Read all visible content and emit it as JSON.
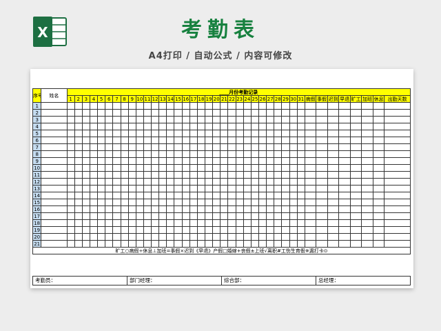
{
  "header": {
    "title": "考勤表",
    "subtitle": "A4打印 / 自动公式 / 内容可修改",
    "logo_icon": "excel-icon",
    "accent": "#17813f"
  },
  "sheet": {
    "col_seq": "序号",
    "col_name": "姓名",
    "month_title": "____月份考勤记录",
    "days": [
      "1",
      "2",
      "3",
      "4",
      "5",
      "6",
      "7",
      "8",
      "9",
      "10",
      "11",
      "12",
      "13",
      "14",
      "15",
      "16",
      "17",
      "18",
      "19",
      "20",
      "21",
      "22",
      "23",
      "24",
      "25",
      "26",
      "27",
      "28",
      "29",
      "30",
      "31"
    ],
    "summary_cols": [
      "病假",
      "事假",
      "迟到",
      "早退",
      "旷工",
      "加班",
      "休息",
      "出勤天数"
    ],
    "rows": [
      "1",
      "2",
      "3",
      "4",
      "5",
      "6",
      "7",
      "8",
      "9",
      "10",
      "11",
      "12",
      "13",
      "14",
      "15",
      "16",
      "17",
      "18",
      "19",
      "20",
      "21"
    ],
    "legend": "旷工○病假÷休息⊥加班=事假×迟到《早退》产假□婚嫁+丧假±上班√离职#工伤生育假※漏打卡⊙",
    "footer": [
      "考勤员：",
      "部门经理：",
      "综合部：",
      "总经理："
    ],
    "header_color": "#ffff00",
    "rownum_color": "#c5dcf0"
  }
}
